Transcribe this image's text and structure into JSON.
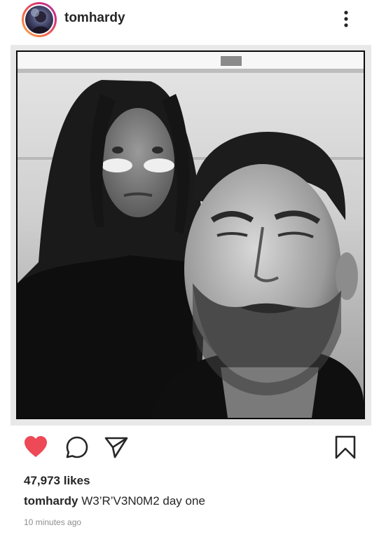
{
  "post": {
    "username": "tomhardy",
    "likes_text": "47,973 likes",
    "caption_user": "tomhardy",
    "caption_text": "W3’R’V3N0M2 day one",
    "timestamp": "10 minutes ago"
  },
  "icons": {
    "like": "heart-icon",
    "comment": "comment-icon",
    "share": "send-icon",
    "save": "bookmark-icon",
    "more": "more-vertical-icon"
  },
  "colors": {
    "liked": "#ed4956",
    "text": "#262626",
    "muted": "#8e8e8e"
  }
}
